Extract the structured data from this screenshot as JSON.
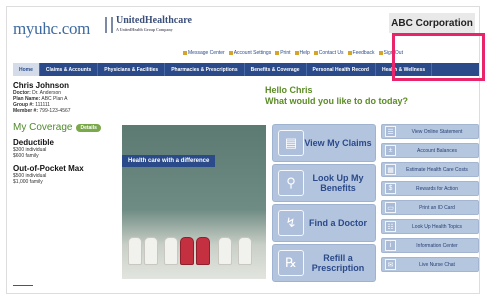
{
  "header": {
    "logo_text": "myuhc.com",
    "brand": "UnitedHealthcare",
    "brand_sub": "A UnitedHealth Group Company",
    "company": "ABC Corporation"
  },
  "utility_links": [
    "Message Center",
    "Account Settings",
    "Print",
    "Help",
    "Contact Us",
    "Feedback",
    "Sign Out"
  ],
  "nav": [
    "Home",
    "Claims & Accounts",
    "Physicians & Facilities",
    "Pharmacies & Prescriptions",
    "Benefits & Coverage",
    "Personal Health Record",
    "Health & Wellness"
  ],
  "member": {
    "name": "Chris Johnson",
    "doctor_label": "Doctor:",
    "doctor": "Dr. Anderson",
    "plan_label": "Plan Name:",
    "plan": "ABC Plan A",
    "group_label": "Group #:",
    "group": "111111",
    "member_label": "Member #:",
    "member_id": "799-123-4567"
  },
  "coverage": {
    "title": "My Coverage",
    "details": "Details",
    "deductible_title": "Deductible",
    "deductible_individual": "$300 individual",
    "deductible_family": "$600 family",
    "oop_title": "Out-of-Pocket Max",
    "oop_individual": "$500 individual",
    "oop_family": "$1,000 family"
  },
  "greeting": {
    "line1": "Hello Chris",
    "line2": "What would you like to do today?"
  },
  "hero_caption": "Health care with a difference",
  "big_buttons": [
    {
      "label": "View My Claims",
      "icon": "document-icon"
    },
    {
      "label": "Look Up My Benefits",
      "icon": "magnifier-icon"
    },
    {
      "label": "Find a Doctor",
      "icon": "stethoscope-icon"
    },
    {
      "label": "Refill a Prescription",
      "icon": "rx-icon"
    }
  ],
  "small_buttons": [
    {
      "label": "View Online Statement",
      "icon": "statement-icon"
    },
    {
      "label": "Account Balances",
      "icon": "plus-minus-icon"
    },
    {
      "label": "Estimate Health Care Costs",
      "icon": "calculator-icon"
    },
    {
      "label": "Rewards for Action",
      "icon": "dollar-icon"
    },
    {
      "label": "Print an ID Card",
      "icon": "id-card-icon"
    },
    {
      "label": "Look Up Health Topics",
      "icon": "book-icon"
    },
    {
      "label": "Information Center",
      "icon": "info-icon"
    },
    {
      "label": "Live Nurse Chat",
      "icon": "chat-icon"
    }
  ],
  "colors": {
    "nav_blue": "#2a4a8a",
    "green": "#5b8c26",
    "highlight": "#e8246a",
    "button_blue": "#b3c4de"
  }
}
